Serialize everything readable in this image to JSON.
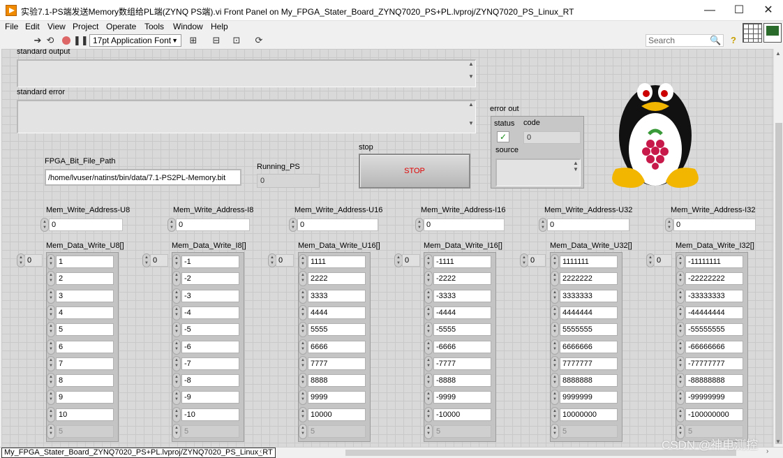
{
  "window": {
    "title": "实验7.1-PS端发送Memory数组给PL端(ZYNQ PS端).vi Front Panel on My_FPGA_Stater_Board_ZYNQ7020_PS+PL.lvproj/ZYNQ7020_PS_Linux_RT",
    "minimize": "—",
    "maximize": "☐",
    "close": "✕"
  },
  "menu": [
    "File",
    "Edit",
    "View",
    "Project",
    "Operate",
    "Tools",
    "Window",
    "Help"
  ],
  "toolbar": {
    "font": "17pt Application Font",
    "search_placeholder": "Search"
  },
  "panel": {
    "std_output_label": "standard output",
    "std_error_label": "standard error",
    "fpga_path_label": "FPGA_Bit_File_Path",
    "fpga_path_value": "/home/lvuser/natinst/bin/data/7.1-PS2PL-Memory.bit",
    "running_label": "Running_PS",
    "running_value": "0",
    "stop_label": "stop",
    "stop_button": "STOP",
    "error_out_label": "error out",
    "status_label": "status",
    "status_value": "✓",
    "code_label": "code",
    "code_value": "0",
    "source_label": "source"
  },
  "address_controls": [
    {
      "label": "Mem_Write_Address-U8",
      "value": "0"
    },
    {
      "label": "Mem_Write_Address-I8",
      "value": "0"
    },
    {
      "label": "Mem_Write_Address-U16",
      "value": "0"
    },
    {
      "label": "Mem_Write_Address-I16",
      "value": "0"
    },
    {
      "label": "Mem_Write_Address-U32",
      "value": "0"
    },
    {
      "label": "Mem_Write_Address-I32",
      "value": "0"
    }
  ],
  "arrays": [
    {
      "label": "Mem_Data_Write_U8[]",
      "index": "0",
      "values": [
        "1",
        "2",
        "3",
        "4",
        "5",
        "6",
        "7",
        "8",
        "9",
        "10"
      ],
      "dim_value": "5"
    },
    {
      "label": "Mem_Data_Write_I8[]",
      "index": "0",
      "values": [
        "-1",
        "-2",
        "-3",
        "-4",
        "-5",
        "-6",
        "-7",
        "-8",
        "-9",
        "-10"
      ],
      "dim_value": "5"
    },
    {
      "label": "Mem_Data_Write_U16[]",
      "index": "0",
      "values": [
        "1111",
        "2222",
        "3333",
        "4444",
        "5555",
        "6666",
        "7777",
        "8888",
        "9999",
        "10000"
      ],
      "dim_value": "5"
    },
    {
      "label": "Mem_Data_Write_I16[]",
      "index": "0",
      "values": [
        "-1111",
        "-2222",
        "-3333",
        "-4444",
        "-5555",
        "-6666",
        "-7777",
        "-8888",
        "-9999",
        "-10000"
      ],
      "dim_value": "5"
    },
    {
      "label": "Mem_Data_Write_U32[]",
      "index": "0",
      "values": [
        "1111111",
        "2222222",
        "3333333",
        "4444444",
        "5555555",
        "6666666",
        "7777777",
        "8888888",
        "9999999",
        "10000000"
      ],
      "dim_value": "5"
    },
    {
      "label": "Mem_Data_Write_I32[]",
      "index": "0",
      "values": [
        "-11111111",
        "-22222222",
        "-33333333",
        "-44444444",
        "-55555555",
        "-66666666",
        "-77777777",
        "-88888888",
        "-99999999",
        "-100000000"
      ],
      "dim_value": "5"
    }
  ],
  "statusbar": {
    "path": "My_FPGA_Stater_Board_ZYNQ7020_PS+PL.lvproj/ZYNQ7020_PS_Linux_RT"
  },
  "watermark": "CSDN @神电测控",
  "colors": {
    "panel": "#d9d9d9",
    "stop_text": "#e00000",
    "status_ok": "#1a8c1a",
    "title_icon": "#f08a00"
  }
}
